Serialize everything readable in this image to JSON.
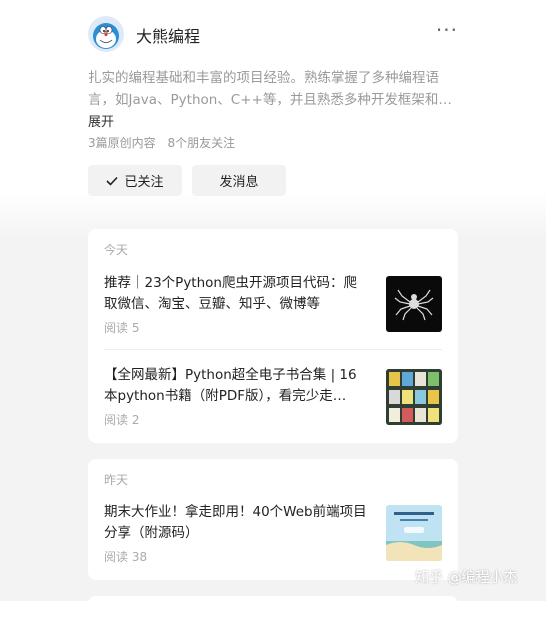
{
  "profile": {
    "name": "大熊编程",
    "bio": "扎实的编程基础和丰富的项目经验。熟练掌握了多种编程语言，如Java、Python、C++等，并且熟悉多种开发框架和…",
    "expand_label": "展开",
    "stats": [
      "3篇原创内容",
      "8个朋友关注"
    ]
  },
  "actions": {
    "follow_label": "已关注",
    "message_label": "发消息"
  },
  "feed": {
    "today": {
      "label": "今天",
      "items": [
        {
          "title": "推荐｜23个Python爬虫开源项目代码：爬取微信、淘宝、豆瓣、知乎、微博等",
          "meta": "阅读 5"
        },
        {
          "title": "【全网最新】Python超全电子书合集 | 16本python书籍（附PDF版），看完少走…",
          "meta": "阅读 2"
        }
      ]
    },
    "yesterday": {
      "label": "昨天",
      "items": [
        {
          "title": "期末大作业！拿走即用！40个Web前端项目分享（附源码）",
          "meta": "阅读 38"
        }
      ]
    }
  },
  "watermark": "知乎 @编程小杰",
  "colors": {
    "card_bg": "#ffffff",
    "page_bg": "#f3f3f3",
    "muted": "#999999"
  }
}
